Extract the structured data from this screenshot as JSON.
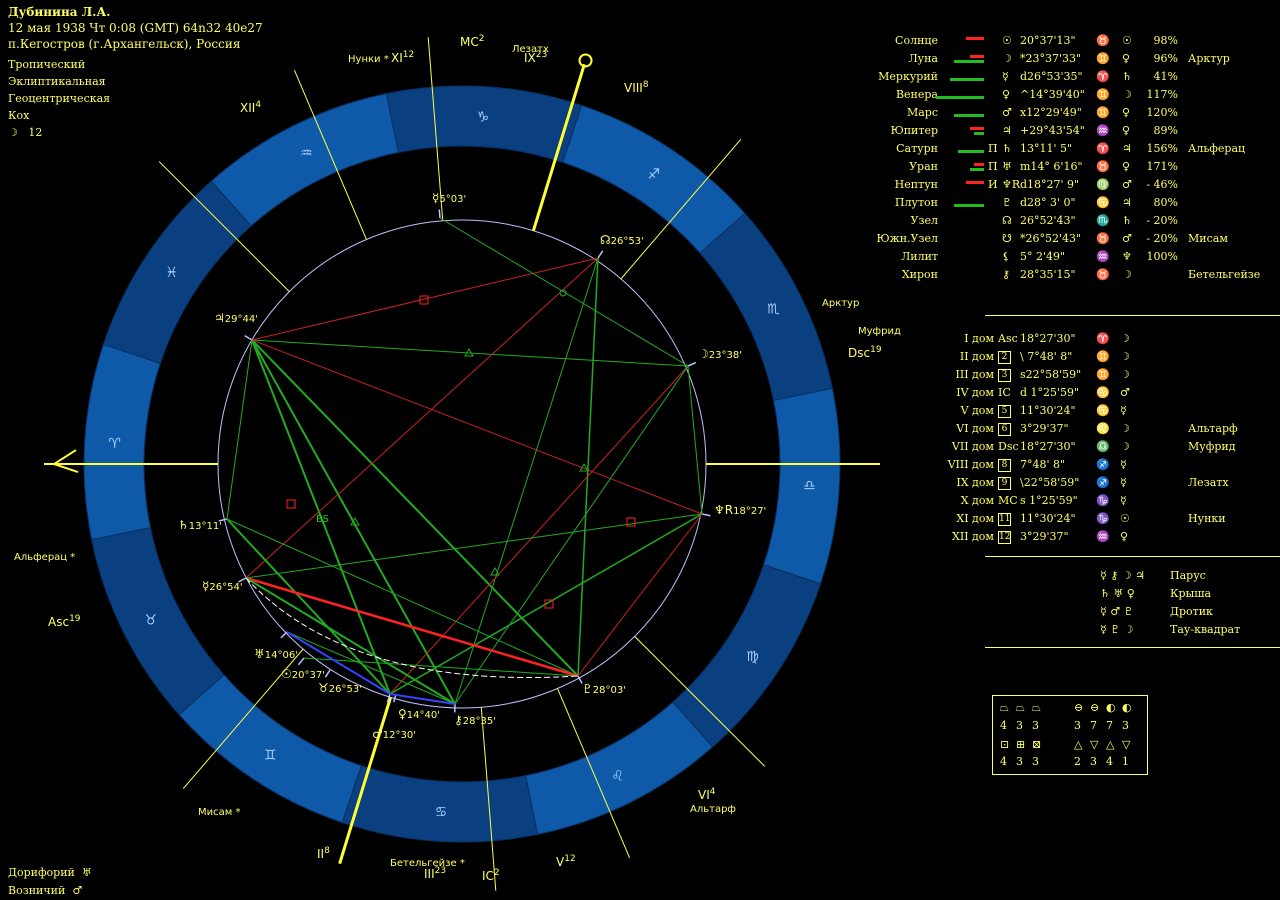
{
  "header": {
    "name": "Дубинина Л.А.",
    "date_line": "12 мая 1938  Чт   0:08 (GMT) 64n32  40e27",
    "place": "п.Кегостров (г.Архангельск), Россия",
    "zodiac": "Тропический",
    "coords": "Эклиптикальная",
    "center": "Геоцентрическая",
    "houses": "Кох",
    "moon_glyph": "☽",
    "moon_day": "12"
  },
  "planets": [
    {
      "name": "Солнце",
      "mark": "",
      "glyph": "☉",
      "pos": " 20°37'13\"",
      "sign": "♉",
      "ruler": "☉",
      "pct": "98%",
      "star": "",
      "bar_g": 0,
      "bar_r": 18
    },
    {
      "name": "Луна",
      "mark": "",
      "glyph": "☽",
      "pos": "*23°37'33\"",
      "sign": "♊",
      "ruler": "♀",
      "pct": "96%",
      "star": "Арктур",
      "bar_g": 30,
      "bar_r": 14
    },
    {
      "name": "Меркурий",
      "mark": "",
      "glyph": "☿",
      "pos": "d26°53'35\"",
      "sign": "♈",
      "ruler": "♄",
      "pct": "41%",
      "star": "",
      "bar_g": 34,
      "bar_r": 0
    },
    {
      "name": "Венера",
      "mark": "",
      "glyph": "♀",
      "pos": "^14°39'40\"",
      "sign": "♊",
      "ruler": "☽",
      "pct": "117%",
      "star": "",
      "bar_g": 48,
      "bar_r": 0
    },
    {
      "name": "Марс",
      "mark": "",
      "glyph": "♂",
      "pos": "x12°29'49\"",
      "sign": "♊",
      "ruler": "♀",
      "pct": "120%",
      "star": "",
      "bar_g": 30,
      "bar_r": 0
    },
    {
      "name": "Юпитер",
      "mark": "",
      "glyph": "♃",
      "pos": "+29°43'54\"",
      "sign": "♒",
      "ruler": "♀",
      "pct": "89%",
      "star": "",
      "bar_g": 10,
      "bar_r": 14
    },
    {
      "name": "Сатурн",
      "mark": "П",
      "glyph": "♄",
      "pos": " 13°11' 5\"",
      "sign": "♈",
      "ruler": "♃",
      "pct": "156%",
      "star": "Альферац",
      "bar_g": 26,
      "bar_r": 0
    },
    {
      "name": "Уран",
      "mark": "П",
      "glyph": "♅",
      "pos": "m14° 6'16\"",
      "sign": "♉",
      "ruler": "♀",
      "pct": "171%",
      "star": "",
      "bar_g": 14,
      "bar_r": 10
    },
    {
      "name": "Нептун",
      "mark": "И",
      "glyph": "♆R",
      "pos": "d18°27' 9\"",
      "sign": "♍",
      "ruler": "♂",
      "pct": "- 46%",
      "star": "",
      "bar_g": 0,
      "bar_r": 18
    },
    {
      "name": "Плутон",
      "mark": "",
      "glyph": "♇",
      "pos": "d28° 3' 0\"",
      "sign": "♋",
      "ruler": "♃",
      "pct": "80%",
      "star": "",
      "bar_g": 30,
      "bar_r": 0
    },
    {
      "name": "Узел",
      "mark": "",
      "glyph": "☊",
      "pos": " 26°52'43\"",
      "sign": "♏",
      "ruler": "♄",
      "pct": "- 20%",
      "star": "",
      "bar_g": 0,
      "bar_r": 0
    },
    {
      "name": "Южн.Узел",
      "mark": "",
      "glyph": "☋",
      "pos": "*26°52'43\"",
      "sign": "♉",
      "ruler": "♂",
      "pct": "- 20%",
      "star": "Мисам",
      "bar_g": 0,
      "bar_r": 0
    },
    {
      "name": "Лилит",
      "mark": "",
      "glyph": "⚸",
      "pos": "  5° 2'49\"",
      "sign": "♒",
      "ruler": "♆",
      "pct": "100%",
      "star": "",
      "bar_g": 0,
      "bar_r": 0
    },
    {
      "name": "Хирон",
      "mark": "",
      "glyph": "⚷",
      "pos": " 28°35'15\"",
      "sign": "♉",
      "ruler": "☽",
      "pct": "",
      "star": "Бетельгейзе",
      "bar_g": 0,
      "bar_r": 0
    }
  ],
  "houses_table": [
    {
      "name": "I дом",
      "cusp": "Asc",
      "pos": " 18°27'30\"",
      "sign": "♈",
      "ruler": "☽",
      "star": ""
    },
    {
      "name": "II дом",
      "cusp": "2",
      "pos": "\\ 7°48' 8\"",
      "sign": "♊",
      "ruler": "☽",
      "star": ""
    },
    {
      "name": "III дом",
      "cusp": "3",
      "pos": "s22°58'59\"",
      "sign": "♊",
      "ruler": "☽",
      "star": ""
    },
    {
      "name": "IV дом",
      "cusp": "IC",
      "pos": "d 1°25'59\"",
      "sign": "♋",
      "ruler": "♂",
      "star": ""
    },
    {
      "name": "V дом",
      "cusp": "5",
      "pos": " 11°30'24\"",
      "sign": "♋",
      "ruler": "☿",
      "star": ""
    },
    {
      "name": "VI дом",
      "cusp": "6",
      "pos": "  3°29'37\"",
      "sign": "♌",
      "ruler": "☽",
      "star": "Альтарф"
    },
    {
      "name": "VII дом",
      "cusp": "Dsc",
      "pos": " 18°27'30\"",
      "sign": "♎",
      "ruler": "☽",
      "star": "Муфрид"
    },
    {
      "name": "VIII дом",
      "cusp": "8",
      "pos": "  7°48' 8\"",
      "sign": "♐",
      "ruler": "☿",
      "star": ""
    },
    {
      "name": "IX дом",
      "cusp": "9",
      "pos": "\\22°58'59\"",
      "sign": "♐",
      "ruler": "☿",
      "star": "Лезатх"
    },
    {
      "name": "X дом",
      "cusp": "MC",
      "pos": "s 1°25'59\"",
      "sign": "♑",
      "ruler": "☿",
      "star": ""
    },
    {
      "name": "XI дом",
      "cusp": "11",
      "pos": " 11°30'24\"",
      "sign": "♑",
      "ruler": "☉",
      "star": "Нунки"
    },
    {
      "name": "XII дом",
      "cusp": "12",
      "pos": "  3°29'37\"",
      "sign": "♒",
      "ruler": "♀",
      "star": ""
    }
  ],
  "configs": [
    {
      "glyphs": "☿ ⚷ ☽ ♃",
      "name": "Парус"
    },
    {
      "glyphs": "♄ ♅ ♀",
      "name": "Крыша"
    },
    {
      "glyphs": "☿ ♂ ♇",
      "name": "Дротик"
    },
    {
      "glyphs": "☿ ♇ ☽",
      "name": "Тау-квадрат"
    }
  ],
  "quadrants": {
    "row1_icons": [
      "⏢",
      "⏢",
      "⏢",
      "⊖",
      "⊖",
      "◐",
      "◐"
    ],
    "row1_vals": [
      "4",
      "3",
      "3",
      "3",
      "7",
      "7",
      "3"
    ],
    "row2_icons": [
      "⊡",
      "⊞",
      "⊠",
      "△",
      "▽",
      "△",
      "▽"
    ],
    "row2_vals": [
      "4",
      "3",
      "3",
      "2",
      "3",
      "4",
      "1"
    ]
  },
  "footer": [
    {
      "label": "Дорифорий",
      "glyph": "♅"
    },
    {
      "label": "Возничий",
      "glyph": "♂"
    }
  ],
  "chart": {
    "axis_labels": {
      "mc": "MC",
      "mc_sup": "2",
      "ic": "IC",
      "ic_sup": "2",
      "asc": "Asc",
      "asc_sup": "19",
      "dsc": "Dsc",
      "dsc_sup": "19"
    },
    "house_labels": [
      {
        "t": "XII",
        "s": "4"
      },
      {
        "t": "XI",
        "s": "12"
      },
      {
        "t": "IX",
        "s": "23"
      },
      {
        "t": "VIII",
        "s": "8"
      },
      {
        "t": "VI",
        "s": "4"
      },
      {
        "t": "V",
        "s": "12"
      },
      {
        "t": "III",
        "s": "23"
      },
      {
        "t": "II",
        "s": "8"
      }
    ],
    "stars": [
      "Нунки",
      "Лезатх",
      "Арктур",
      "Муфрид",
      "Альтарф",
      "Бетельгейзе",
      "Мисам",
      "Альферац"
    ],
    "planet_labels": [
      {
        "g": "☿",
        "t": "5°03'"
      },
      {
        "g": "☊",
        "t": "26°53'"
      },
      {
        "g": "♃",
        "t": "29°44'"
      },
      {
        "g": "☽",
        "t": "23°38'"
      },
      {
        "g": "♆R",
        "t": "18°27'"
      },
      {
        "g": "♄",
        "t": "13°11'"
      },
      {
        "g": "☿",
        "t": "26°54'"
      },
      {
        "g": "♅",
        "t": "14°06'"
      },
      {
        "g": "☉",
        "t": "20°37'"
      },
      {
        "g": "♉",
        "t": "26°53'"
      },
      {
        "g": "♀",
        "t": "14°40'"
      },
      {
        "g": "♂",
        "t": "12°30'"
      },
      {
        "g": "⚷",
        "t": "28°35'"
      },
      {
        "g": "♇",
        "t": "28°03'"
      }
    ],
    "zodiac_glyphs": [
      "♑",
      "♐",
      "♏",
      "♎",
      "♍",
      "♌",
      "♋",
      "♊",
      "♉",
      "♈",
      "♓",
      "♒"
    ],
    "aspect_mark": "BS"
  }
}
